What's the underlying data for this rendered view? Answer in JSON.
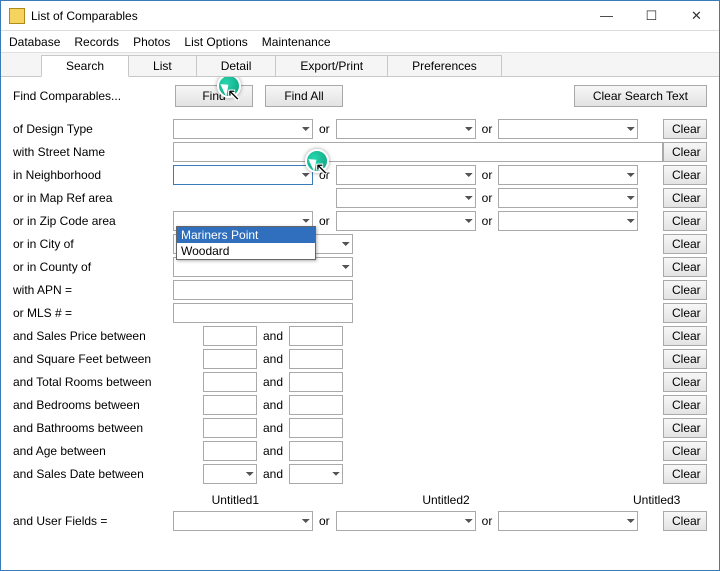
{
  "window": {
    "title": "List of Comparables",
    "min_tooltip": "Minimize",
    "max_tooltip": "Maximize",
    "close_tooltip": "Close"
  },
  "menu": {
    "database": "Database",
    "records": "Records",
    "photos": "Photos",
    "list_options": "List Options",
    "maintenance": "Maintenance"
  },
  "tabs": {
    "search": "Search",
    "list": "List",
    "detail": "Detail",
    "export_print": "Export/Print",
    "preferences": "Preferences"
  },
  "top": {
    "find_comparables": "Find Comparables...",
    "find": "Find",
    "find_all": "Find All",
    "clear_search": "Clear Search Text"
  },
  "labels": {
    "design_type": "of Design Type",
    "street_name": "with Street Name",
    "neighborhood": "in Neighborhood",
    "map_ref": "or in Map Ref area",
    "zip": "or in Zip Code area",
    "city": "or in City of",
    "county": "or in County of",
    "apn": "with APN =",
    "mls": "or MLS # =",
    "sales_price": "and Sales Price between",
    "sqft": "and Square Feet between",
    "rooms": "and Total Rooms between",
    "bedrooms": "and Bedrooms between",
    "bathrooms": "and Bathrooms between",
    "age": "and Age between",
    "sales_date": "and Sales Date between",
    "user_fields": "and User Fields ="
  },
  "common": {
    "or": "or",
    "and": "and",
    "clear": "Clear"
  },
  "neighborhood_dropdown": {
    "value": "",
    "options": [
      "Mariners Point",
      "Woodard"
    ]
  },
  "user_field_headers": {
    "u1": "Untitled1",
    "u2": "Untitled2",
    "u3": "Untitled3"
  }
}
